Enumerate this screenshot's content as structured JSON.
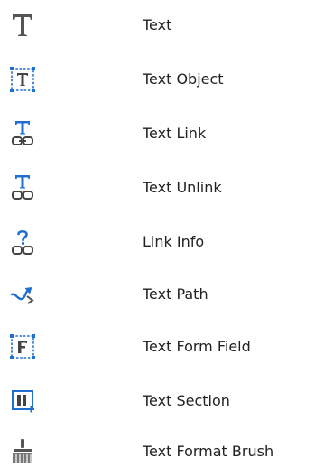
{
  "accent_color": "#1f6fd1",
  "icon_gray": "#555555",
  "tools": [
    {
      "label": "Text",
      "icon": "text-icon"
    },
    {
      "label": "Text Object",
      "icon": "text-object-icon"
    },
    {
      "label": "Text Link",
      "icon": "text-link-icon"
    },
    {
      "label": "Text Unlink",
      "icon": "text-unlink-icon"
    },
    {
      "label": "Link Info",
      "icon": "link-info-icon"
    },
    {
      "label": "Text Path",
      "icon": "text-path-icon"
    },
    {
      "label": "Text Form Field",
      "icon": "text-form-field-icon"
    },
    {
      "label": "Text Section",
      "icon": "text-section-icon"
    },
    {
      "label": "Text Format Brush",
      "icon": "text-format-brush-icon"
    }
  ]
}
